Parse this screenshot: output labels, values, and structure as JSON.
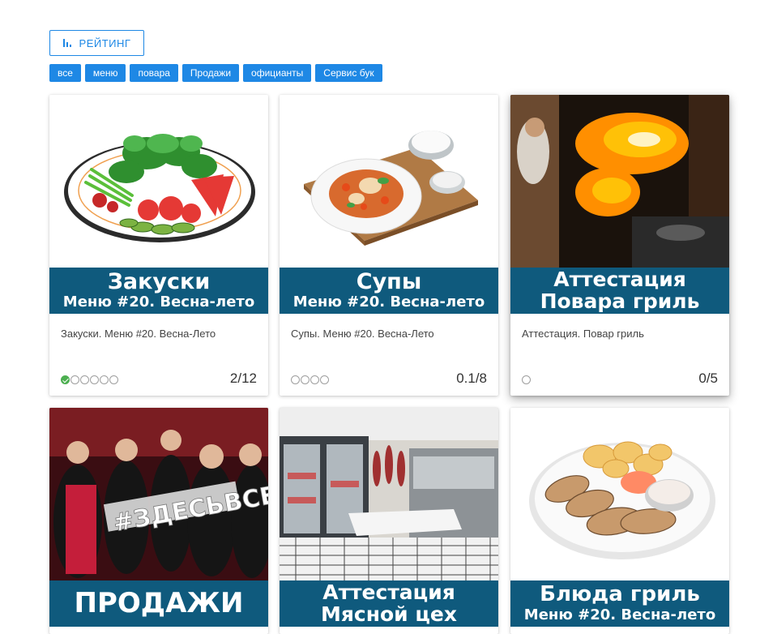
{
  "toolbar": {
    "rating_label": "РЕЙТИНГ",
    "rating_icon": "bar-chart-icon"
  },
  "filters": [
    "все",
    "меню",
    "повара",
    "Продажи",
    "официанты",
    "Сервис бук"
  ],
  "colors": {
    "accent": "#1e88e5",
    "banner": "#0f5a7d",
    "done": "#4caf50"
  },
  "cards": [
    {
      "banner1": "Закуски",
      "banner2": "Меню #20. Весна-лето",
      "desc": "Закуски. Меню #20. Весна-Лето",
      "progress_total": 6,
      "progress_done": 1,
      "score": "2/12",
      "image": "salad-plate"
    },
    {
      "banner1": "Супы",
      "banner2": "Меню #20. Весна-лето",
      "desc": "Супы. Меню #20. Весна-Лето",
      "progress_total": 4,
      "progress_done": 0,
      "score": "0.1/8",
      "image": "soup-bowl"
    },
    {
      "banner1": "Аттестация",
      "banner2": "Повара гриль",
      "desc": "Аттестация. Повар гриль",
      "progress_total": 1,
      "progress_done": 0,
      "score": "0/5",
      "image": "chef-flames"
    },
    {
      "banner1": "ПРОДАЖИ",
      "banner2": "",
      "image": "staff-photo",
      "photo_text": "#ЗДЕСЬВСЕ"
    },
    {
      "banner1": "Аттестация",
      "banner2": "Мясной цех",
      "image": "meat-shop"
    },
    {
      "banner1": "Блюда гриль",
      "banner2": "Меню #20. Весна-лето",
      "image": "grill-plate"
    }
  ]
}
